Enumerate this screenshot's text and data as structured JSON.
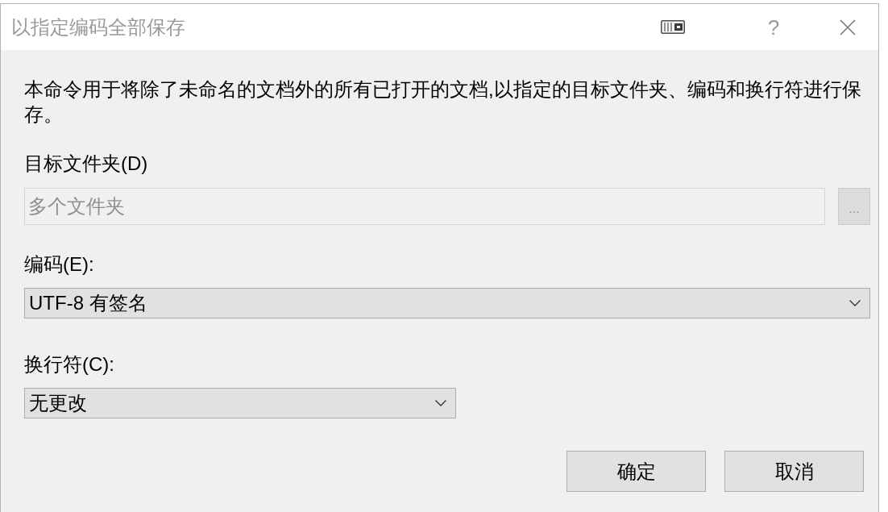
{
  "window": {
    "title": "以指定编码全部保存",
    "help_button": "?"
  },
  "description": "本命令用于将除了未命名的文档外的所有已打开的文档,以指定的目标文件夹、编码和换行符进行保存。",
  "target_folder": {
    "label": "目标文件夹(D)",
    "value": "多个文件夹",
    "disabled": true,
    "browse_button": {
      "label": "...",
      "disabled": true
    }
  },
  "encoding": {
    "label": "编码(E):",
    "value": "UTF-8 有签名"
  },
  "line_ending": {
    "label": "换行符(C):",
    "value": "无更改"
  },
  "buttons": [
    "确定",
    "取消"
  ]
}
